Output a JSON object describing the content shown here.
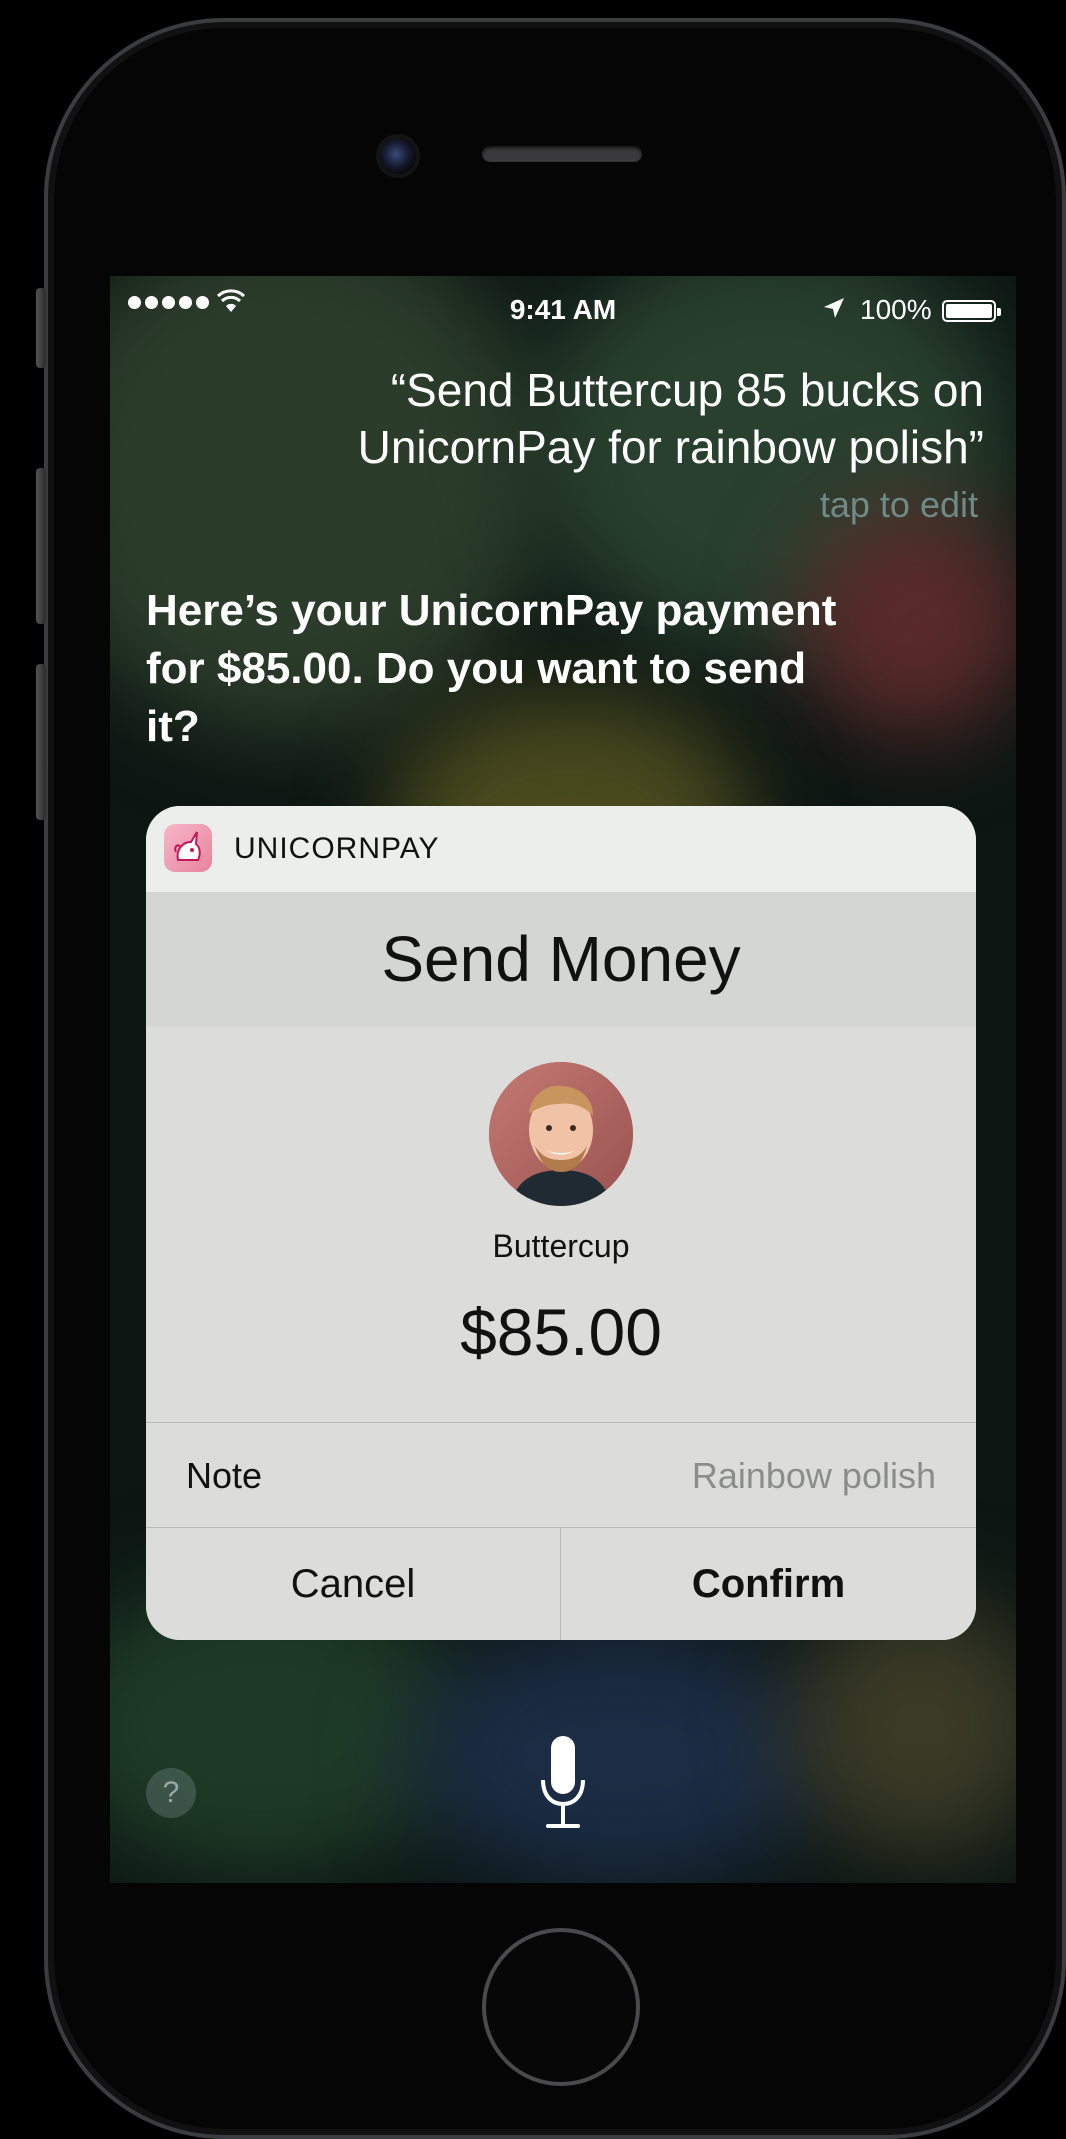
{
  "status_bar": {
    "time": "9:41 AM",
    "battery": "100%"
  },
  "siri": {
    "query": "“Send Buttercup 85 bucks on UnicornPay for rainbow polish”",
    "tap_to_edit": "tap to edit",
    "response": "Here’s your UnicornPay payment for $85.00. Do you want to send it?"
  },
  "card": {
    "app_name": "UNICORNPAY",
    "title": "Send Money",
    "recipient": "Buttercup",
    "amount": "$85.00",
    "note_label": "Note",
    "note_value": "Rainbow polish",
    "cancel_label": "Cancel",
    "confirm_label": "Confirm"
  },
  "bottom": {
    "help_label": "?"
  },
  "colors": {
    "card_background": "#d9dad8",
    "tap_to_edit": "#6f8a86"
  }
}
